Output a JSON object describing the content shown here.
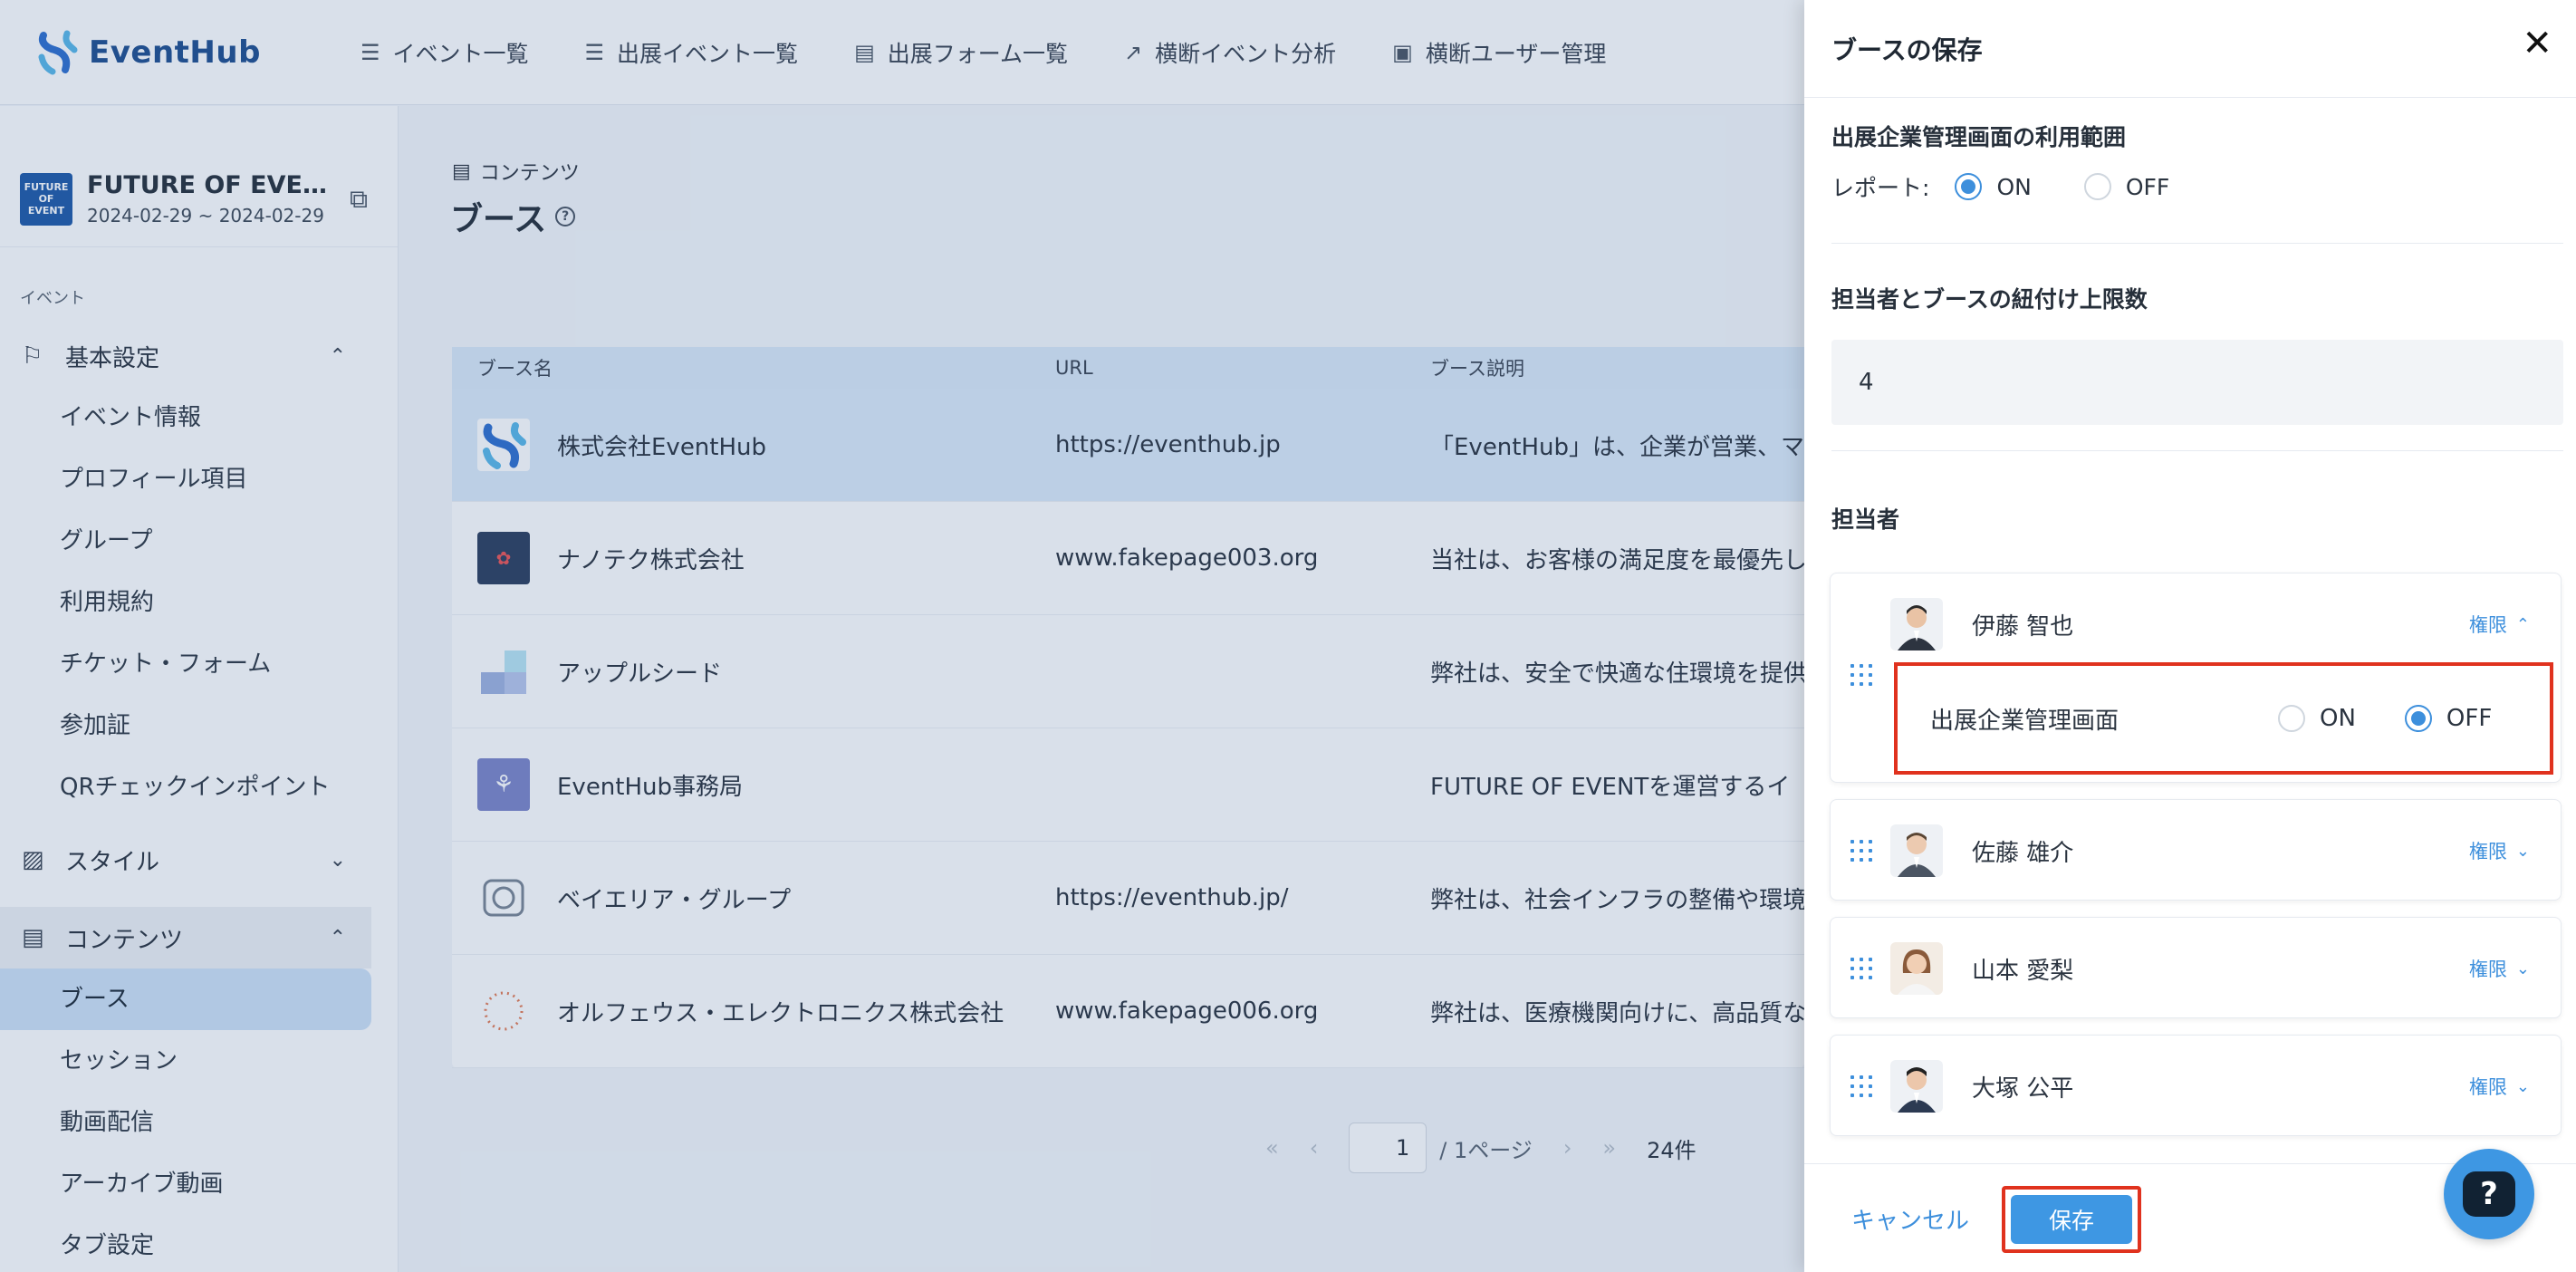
{
  "app": {
    "logo_text": "EventHub"
  },
  "nav": [
    {
      "icon": "list-icon",
      "glyph": "☰",
      "label": "イベント一覧"
    },
    {
      "icon": "list-icon",
      "glyph": "☰",
      "label": "出展イベント一覧"
    },
    {
      "icon": "form-icon",
      "glyph": "▤",
      "label": "出展フォーム一覧"
    },
    {
      "icon": "chart-icon",
      "glyph": "↗",
      "label": "横断イベント分析"
    },
    {
      "icon": "user-card-icon",
      "glyph": "▣",
      "label": "横断ユーザー管理"
    }
  ],
  "event": {
    "thumb_text": "FUTURE OF EVENT",
    "name": "FUTURE OF EVEN…",
    "dates": "2024-02-29 ~ 2024-02-29"
  },
  "sidebar": {
    "section_label": "イベント",
    "basic_group": "基本設定",
    "basic_items": [
      "イベント情報",
      "プロフィール項目",
      "グループ",
      "利用規約",
      "チケット・フォーム",
      "参加証",
      "QRチェックインポイント"
    ],
    "style_group": "スタイル",
    "content_group": "コンテンツ",
    "content_items": [
      "ブース",
      "セッション",
      "動画配信",
      "アーカイブ動画",
      "タブ設定"
    ]
  },
  "main": {
    "breadcrumb": "コンテンツ",
    "title": "ブース",
    "help_glyph": "?"
  },
  "table": {
    "headers": [
      "ブース名",
      "URL",
      "ブース説明"
    ],
    "rows": [
      {
        "name": "株式会社EventHub",
        "url": "https://eventhub.jp",
        "desc": "「EventHub」は、企業が営業、マ",
        "logo_color": "#ffffff"
      },
      {
        "name": "ナノテク株式会社",
        "url": "www.fakepage003.org",
        "desc": "当社は、お客様の満足度を最優先し",
        "logo_color": "#2d3f5e"
      },
      {
        "name": "アップルシード",
        "url": "",
        "desc": "弊社は、安全で快適な住環境を提供",
        "logo_color": "#bcd3ee"
      },
      {
        "name": "EventHub事務局",
        "url": "",
        "desc": "FUTURE OF EVENTを運営するイ",
        "logo_color": "#7d86c9"
      },
      {
        "name": "ベイエリア・グループ",
        "url": "https://eventhub.jp/",
        "desc": "弊社は、社会インフラの整備や環境",
        "logo_color": "#ffffff"
      },
      {
        "name": "オルフェウス・エレクトロニクス株式会社",
        "url": "www.fakepage006.org",
        "desc": "弊社は、医療機関向けに、高品質な",
        "logo_color": "#ffffff"
      }
    ]
  },
  "pager": {
    "page": "1",
    "of_pages": "/ 1ページ",
    "total": "24件"
  },
  "drawer": {
    "title": "ブースの保存",
    "close_glyph": "✕",
    "scope_label": "出展企業管理画面の利用範囲",
    "report_label": "レポート:",
    "report_on": "ON",
    "report_off": "OFF",
    "report_value": "ON",
    "limit_label": "担当者とブースの紐付け上限数",
    "limit_value": "4",
    "staff_label": "担当者",
    "staff": [
      {
        "name": "伊藤 智也",
        "perm": "権限",
        "expanded": true,
        "chevron": "⌃"
      },
      {
        "name": "佐藤 雄介",
        "perm": "権限",
        "expanded": false,
        "chevron": "⌄"
      },
      {
        "name": "山本 愛梨",
        "perm": "権限",
        "expanded": false,
        "chevron": "⌄"
      },
      {
        "name": "大塚 公平",
        "perm": "権限",
        "expanded": false,
        "chevron": "⌄"
      }
    ],
    "perm_panel": {
      "label": "出展企業管理画面",
      "on": "ON",
      "off": "OFF",
      "value": "OFF"
    },
    "cancel": "キャンセル",
    "save": "保存"
  },
  "colors": {
    "accent": "#3e97e3",
    "highlight": "#e0321e",
    "brand": "#1f4f8f"
  }
}
